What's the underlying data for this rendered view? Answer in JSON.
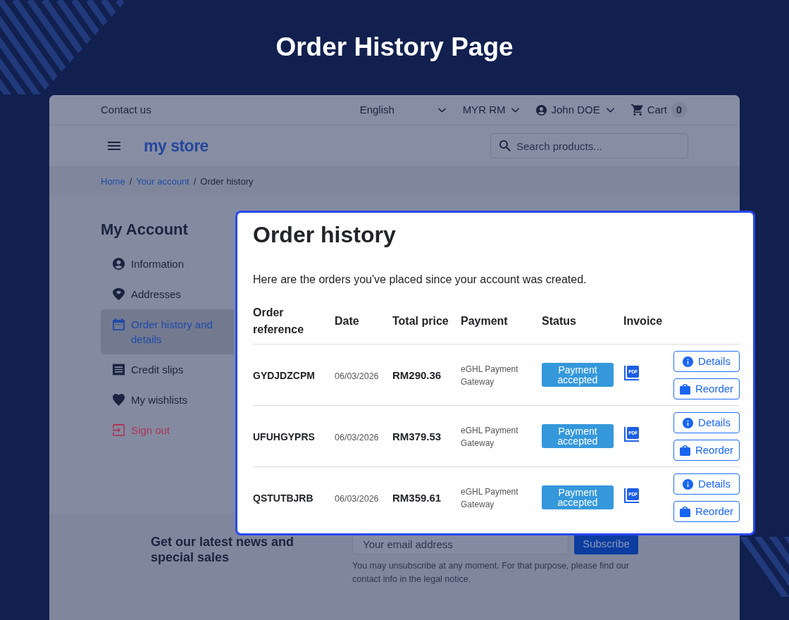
{
  "banner": {
    "title": "Order History Page"
  },
  "top_bar": {
    "contact": "Contact us",
    "language": "English",
    "currency": "MYR RM",
    "account": "John DOE",
    "cart": {
      "label": "Cart",
      "count": "0"
    }
  },
  "header": {
    "logo": "my store",
    "search": {
      "placeholder": "Search products..."
    }
  },
  "breadcrumb": [
    {
      "kind": "link",
      "label": "Home"
    },
    {
      "kind": "separator",
      "label": "/"
    },
    {
      "kind": "link",
      "label": "Your account"
    },
    {
      "kind": "separator",
      "label": "/"
    },
    {
      "kind": "current",
      "label": "Order history"
    }
  ],
  "sidebar": {
    "title": "My Account",
    "items": [
      {
        "label": "Information",
        "kind": "link",
        "selected": false
      },
      {
        "label": "Addresses",
        "kind": "link",
        "selected": false
      },
      {
        "label": "Order history and details",
        "kind": "link",
        "selected": true
      },
      {
        "label": "Credit slips",
        "kind": "link",
        "selected": false
      },
      {
        "label": "My wishlists",
        "kind": "link",
        "selected": false
      },
      {
        "label": "Sign out",
        "kind": "logout",
        "selected": false
      }
    ]
  },
  "order_history": {
    "title": "Order history",
    "intro": "Here are the orders you've placed since your account was created.",
    "columns": [
      "Order reference",
      "Date",
      "Total price",
      "Payment",
      "Status",
      "Invoice"
    ],
    "rows": [
      {
        "reference": "GYDJDZCPM",
        "date": "06/03/2026",
        "total": "RM290.36",
        "payment": "eGHL Payment Gateway",
        "status": "Payment accepted",
        "invoice": "PDF",
        "actions": [
          "Details",
          "Reorder"
        ]
      },
      {
        "reference": "UFUHGYPRS",
        "date": "06/03/2026",
        "total": "RM379.53",
        "payment": "eGHL Payment Gateway",
        "status": "Payment accepted",
        "invoice": "PDF",
        "actions": [
          "Details",
          "Reorder"
        ]
      },
      {
        "reference": "QSTUTBJRB",
        "date": "06/03/2026",
        "total": "RM359.61",
        "payment": "eGHL Payment Gateway",
        "status": "Payment accepted",
        "invoice": "PDF",
        "actions": [
          "Details",
          "Reorder"
        ]
      }
    ]
  },
  "newsletter": {
    "heading": "Get our latest news and special sales",
    "email": {
      "placeholder": "Your email address"
    },
    "button": "Subscribe",
    "note": "You may unsubscribe at any moment. For that purpose, please find our contact info in the legal notice."
  }
}
